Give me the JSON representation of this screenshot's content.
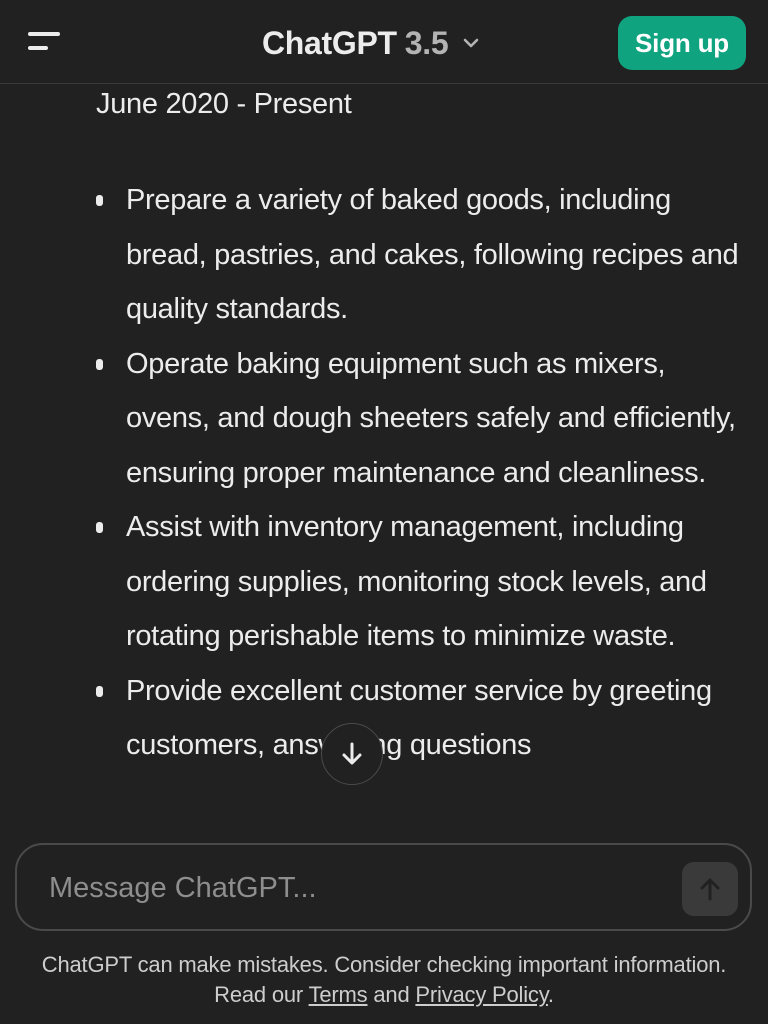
{
  "header": {
    "model_name": "ChatGPT",
    "model_version": "3.5",
    "signup_label": "Sign up"
  },
  "content": {
    "date_line": "June 2020 - Present",
    "bullets": [
      "Prepare a variety of baked goods, including bread, pastries, and cakes, following recipes and quality standards.",
      "Operate baking equipment such as mixers, ovens, and dough sheeters safely and efficiently, ensuring proper maintenance and cleanliness.",
      "Assist with inventory management, including ordering supplies, monitoring stock levels, and rotating perishable items to minimize waste.",
      "Provide excellent customer service by greeting customers, answering questions"
    ]
  },
  "composer": {
    "placeholder": "Message ChatGPT..."
  },
  "footer": {
    "disclaimer": "ChatGPT can make mistakes. Consider checking important information.",
    "read_prefix": "Read our ",
    "terms_label": "Terms",
    "and_text": " and ",
    "privacy_label": "Privacy Policy",
    "period": "."
  },
  "icons": {
    "menu": "menu-icon",
    "chevron": "chevron-down-icon",
    "scroll_down": "arrow-down-icon",
    "send": "arrow-up-icon"
  },
  "colors": {
    "background": "#212121",
    "accent": "#10a37f",
    "text": "#ececec"
  }
}
